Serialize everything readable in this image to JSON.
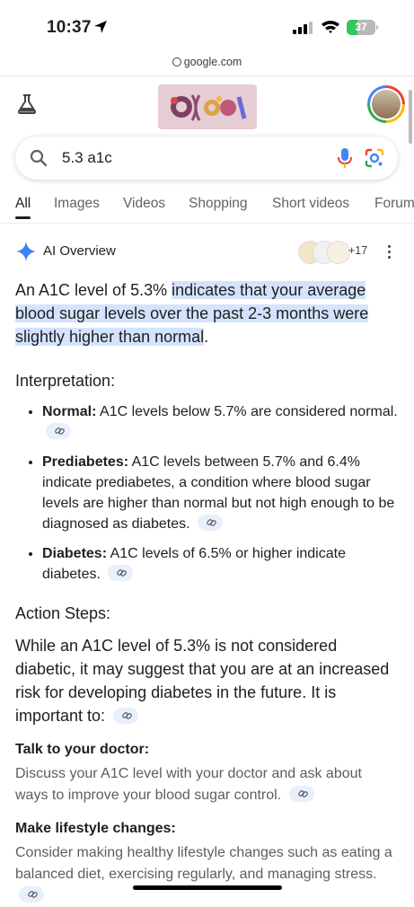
{
  "status_bar": {
    "time": "10:37",
    "battery": "37"
  },
  "url_bar": {
    "domain": "google.com"
  },
  "search": {
    "query": "5.3 a1c"
  },
  "tabs": [
    "All",
    "Images",
    "Videos",
    "Shopping",
    "Short videos",
    "Forum"
  ],
  "ai_overview": {
    "label": "AI Overview",
    "sources_more": "+17",
    "lead_plain": "An A1C level of 5.3% ",
    "lead_highlight": "indicates that your average blood sugar levels over the past 2-3 months were slightly higher than normal",
    "lead_end": ".",
    "interpretation_heading": "Interpretation:",
    "items": [
      {
        "term": "Normal:",
        "text": " A1C levels below 5.7% are considered normal."
      },
      {
        "term": "Prediabetes:",
        "text": " A1C levels between 5.7% and 6.4% indicate prediabetes, a condition where blood sugar levels are higher than normal but not high enough to be diagnosed as diabetes."
      },
      {
        "term": "Diabetes:",
        "text": " A1C levels of 6.5% or higher indicate diabetes."
      }
    ],
    "action_heading": "Action Steps:",
    "action_text": "While an A1C level of 5.3% is not considered diabetic, it may suggest that you are at an increased risk for developing diabetes in the future. It is important to:",
    "steps": [
      {
        "title": "Talk to your doctor:",
        "text": "Discuss your A1C level with your doctor and ask about ways to improve your blood sugar control."
      },
      {
        "title": "Make lifestyle changes:",
        "text": "Consider making healthy lifestyle changes such as eating a balanced diet, exercising regularly, and managing stress."
      }
    ]
  },
  "icons": [
    "location-arrow-icon",
    "cellular-icon",
    "wifi-icon",
    "battery-icon",
    "lock-icon",
    "labs-flask-icon",
    "search-icon",
    "mic-icon",
    "google-lens-icon",
    "gemini-sparkle-icon",
    "more-vert-icon",
    "link-icon"
  ]
}
